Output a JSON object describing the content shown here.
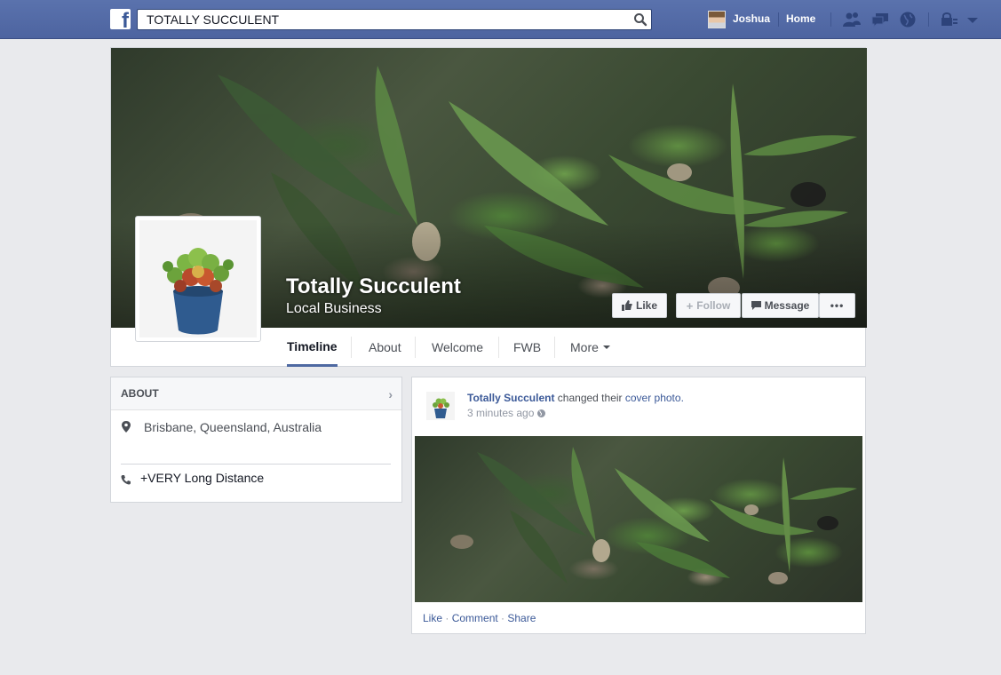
{
  "topbar": {
    "search_value": "TOTALLY SUCCULENT",
    "user_name": "Joshua",
    "home_label": "Home"
  },
  "cover": {
    "page_name": "Totally Succulent",
    "category": "Local Business",
    "buttons": {
      "like": "Like",
      "follow": "Follow",
      "message": "Message",
      "more": "•••"
    }
  },
  "tabs": {
    "timeline": "Timeline",
    "about": "About",
    "welcome": "Welcome",
    "fwb": "FWB",
    "more": "More"
  },
  "about": {
    "heading": "ABOUT",
    "location": "Brisbane, Queensland, Australia",
    "phone": "+VERY Long Distance"
  },
  "post": {
    "author": "Totally Succulent",
    "action_text": " changed their ",
    "action_link": "cover photo.",
    "time": "3 minutes ago",
    "actions": {
      "like": "Like",
      "comment": "Comment",
      "share": "Share",
      "separator": " · "
    }
  },
  "colors": {
    "topbar": "#4d64a0",
    "link": "#3b5998",
    "tab_underline": "#4e69a2",
    "background": "#e9eaed"
  }
}
